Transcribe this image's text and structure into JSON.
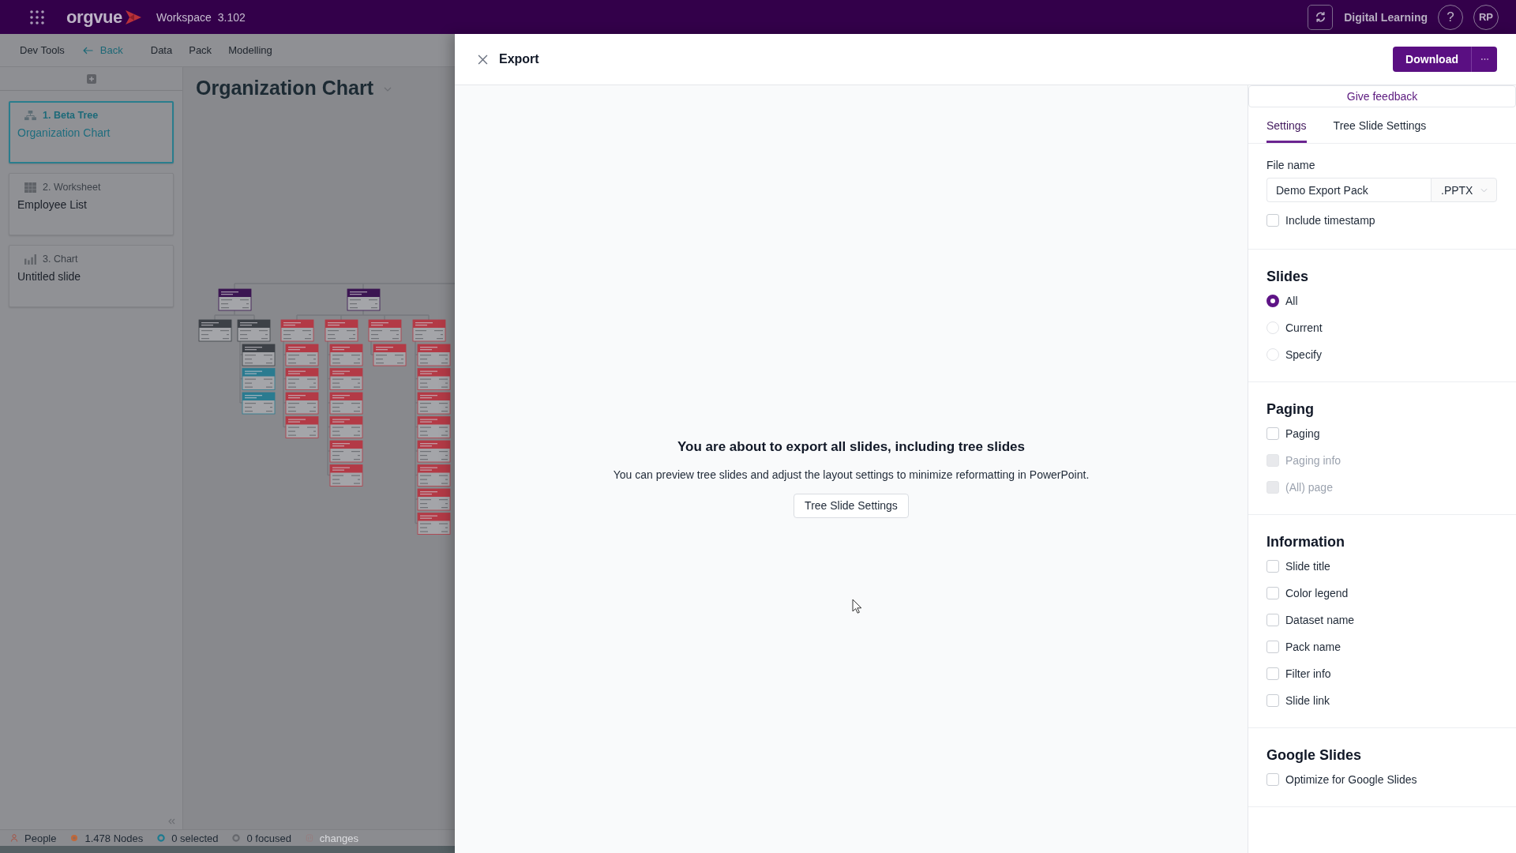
{
  "top_bar": {
    "brand": "orgvue",
    "workspace": "Workspace",
    "version": "3.102",
    "organization": "Digital Learning",
    "help": "?",
    "user_initials": "RP"
  },
  "toolbar": [
    {
      "kind": "text",
      "label": "Dev Tools"
    },
    {
      "kind": "back",
      "label": "Back"
    },
    {
      "kind": "text",
      "label": "Data"
    },
    {
      "kind": "text",
      "label": "Pack"
    },
    {
      "kind": "text",
      "label": "Modelling"
    }
  ],
  "slides": [
    {
      "kind": "tree",
      "type_label": "1. Beta Tree",
      "title": "Organization Chart",
      "selected": true
    },
    {
      "kind": "worksheet",
      "type_label": "2. Worksheet",
      "title": "Employee List",
      "selected": false
    },
    {
      "kind": "chart",
      "type_label": "3. Chart",
      "title": "Untitled slide",
      "selected": false
    }
  ],
  "canvas": {
    "title": "Organization Chart"
  },
  "status_bar": [
    {
      "kind": "people",
      "label": "People",
      "disabled": false
    },
    {
      "kind": "nodes",
      "label": "1.478 Nodes",
      "disabled": false
    },
    {
      "kind": "selected",
      "label": "0 selected",
      "disabled": false
    },
    {
      "kind": "focused",
      "label": "0 focused",
      "disabled": false
    },
    {
      "kind": "changes",
      "label": "changes",
      "disabled": true
    }
  ],
  "export": {
    "title": "Export",
    "download": "Download"
  },
  "preview": {
    "heading": "You are about to export all slides, including tree slides",
    "message": "You can preview tree slides and adjust the layout settings to minimize reformatting in PowerPoint.",
    "button": "Tree Slide Settings"
  },
  "settings": {
    "feedback": "Give feedback",
    "tabs": [
      {
        "label": "Settings",
        "selected": true
      },
      {
        "label": "Tree Slide Settings",
        "selected": false
      }
    ],
    "file_name": {
      "label": "File name",
      "value": "Demo Export Pack",
      "format": ".PPTX"
    },
    "timestamp": {
      "label": "Include timestamp",
      "checked": false
    },
    "sections": [
      {
        "heading": "Slides",
        "options": [
          {
            "kind": "radio",
            "label": "All",
            "selected": true
          },
          {
            "kind": "radio",
            "label": "Current",
            "selected": false
          },
          {
            "kind": "radio",
            "label": "Specify",
            "selected": false
          }
        ]
      },
      {
        "heading": "Paging",
        "options": [
          {
            "kind": "checkbox",
            "label": "Paging",
            "checked": false,
            "disabled": false
          },
          {
            "kind": "checkbox",
            "label": "Paging info",
            "checked": false,
            "disabled": true
          },
          {
            "kind": "checkbox",
            "label": "(All) page",
            "checked": false,
            "disabled": true
          }
        ]
      },
      {
        "heading": "Information",
        "options": [
          {
            "kind": "checkbox",
            "label": "Slide title",
            "checked": false
          },
          {
            "kind": "checkbox",
            "label": "Color legend",
            "checked": false
          },
          {
            "kind": "checkbox",
            "label": "Dataset name",
            "checked": false
          },
          {
            "kind": "checkbox",
            "label": "Pack name",
            "checked": false
          },
          {
            "kind": "checkbox",
            "label": "Filter info",
            "checked": false
          },
          {
            "kind": "checkbox",
            "label": "Slide link",
            "checked": false
          }
        ]
      },
      {
        "heading": "Google Slides",
        "options": [
          {
            "kind": "checkbox",
            "label": "Optimize for Google Slides",
            "checked": false
          }
        ]
      }
    ]
  }
}
